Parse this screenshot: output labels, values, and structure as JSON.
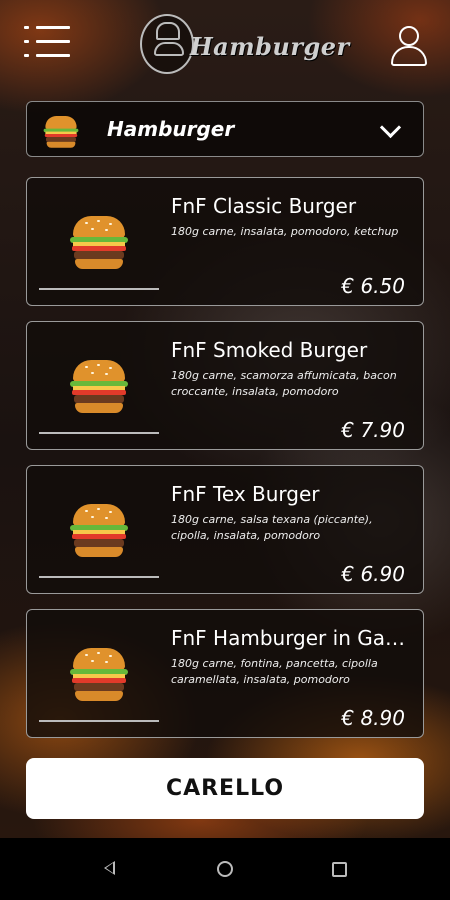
{
  "header": {
    "menu_icon": "hamburger-menu-icon",
    "logo_text": "Hamburger",
    "user_icon": "user-icon"
  },
  "category": {
    "icon": "burger-icon",
    "label": "Hamburger",
    "chevron": "chevron-down-icon"
  },
  "menu": {
    "items": [
      {
        "name": "FnF Classic Burger",
        "description": "180g carne, insalata, pomodoro, ketchup",
        "price": "€ 6.50"
      },
      {
        "name": "FnF Smoked Burger",
        "description": "180g carne, scamorza affumicata, bacon croccante, insalata, pomodoro",
        "price": "€ 7.90"
      },
      {
        "name": "FnF Tex Burger",
        "description": "180g carne, salsa texana (piccante), cipolla, insalata, pomodoro",
        "price": "€ 6.90"
      },
      {
        "name": "FnF Hamburger in Gab...",
        "description": "180g carne, fontina, pancetta, cipolla caramellata, insalata, pomodoro",
        "price": "€ 8.90"
      }
    ]
  },
  "cart_button": {
    "label": "CARELLO"
  },
  "system_nav": {
    "back_icon": "back-triangle-icon",
    "home_icon": "home-circle-icon",
    "recents_icon": "recents-square-icon"
  }
}
